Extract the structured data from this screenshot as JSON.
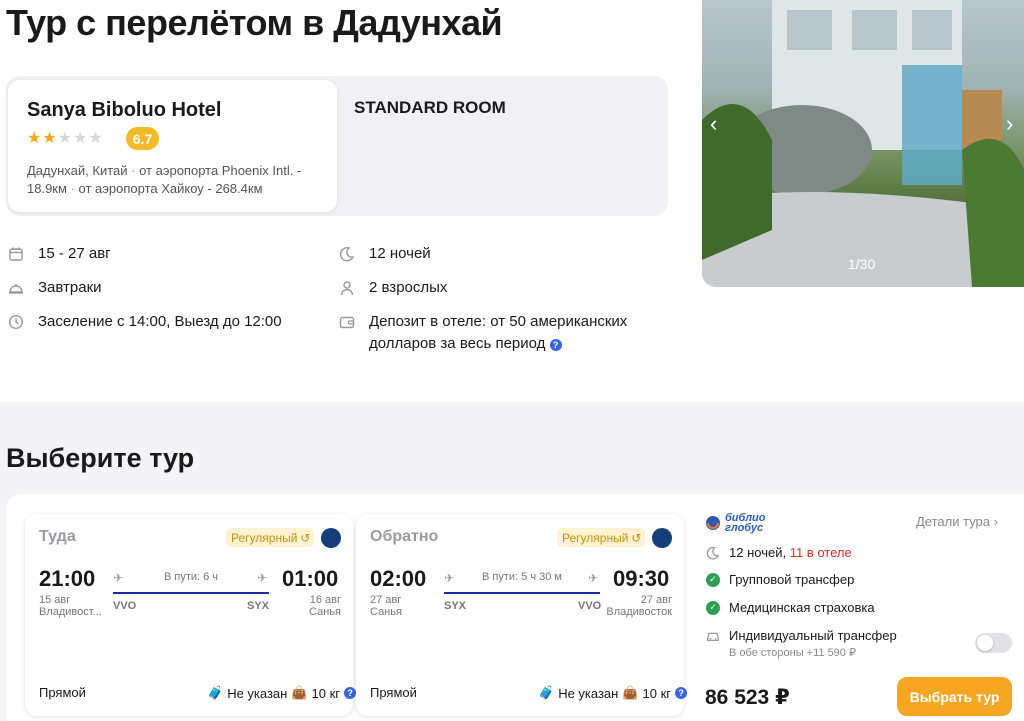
{
  "page": {
    "title": "Тур с перелётом в Дадунхай"
  },
  "hotel": {
    "name": "Sanya Biboluo Hotel",
    "stars": 2,
    "max_stars": 5,
    "rating": "6.7",
    "location": "Дадунхай, Китай",
    "distance_1": "от аэропорта Phoenix Intl. - 18.9км",
    "distance_2": "от аэропорта Хайкоу - 268.4км",
    "room": "STANDARD ROOM"
  },
  "info": {
    "dates": "15 - 27 авг",
    "nights": "12 ночей",
    "meals": "Завтраки",
    "guests": "2 взрослых",
    "checkin": "Заселение с 14:00, Выезд до 12:00",
    "deposit": "Депозит в отеле: от 50 американских долларов за весь период"
  },
  "gallery": {
    "counter": "1/30"
  },
  "tour_section": {
    "title": "Выберите тур"
  },
  "flights": {
    "outbound": {
      "title": "Туда",
      "badge": "Регулярный",
      "depart_time": "21:00",
      "depart_date": "15 авг",
      "depart_city": "Владивост...",
      "depart_code": "VVO",
      "duration": "В пути: 6 ч",
      "arrive_time": "01:00",
      "arrive_date": "16 авг",
      "arrive_city": "Санья",
      "arrive_code": "SYX",
      "type": "Прямой",
      "baggage": "Не указан",
      "hand_luggage": "10 кг"
    },
    "return": {
      "title": "Обратно",
      "badge": "Регулярный",
      "depart_time": "02:00",
      "depart_date": "27 авг",
      "depart_city": "Санья",
      "depart_code": "SYX",
      "duration": "В пути: 5 ч 30 м",
      "arrive_time": "09:30",
      "arrive_date": "27 авг",
      "arrive_city": "Владивосток",
      "arrive_code": "VVO",
      "type": "Прямой",
      "baggage": "Не указан",
      "hand_luggage": "10 кг"
    }
  },
  "summary": {
    "operator_line1": "библио",
    "operator_line2": "глобус",
    "details_link": "Детали тура",
    "nights": "12 ночей,",
    "nights_hotel": "11 в отеле",
    "transfer": "Групповой трансфер",
    "insurance": "Медицинская страховка",
    "individual_transfer": "Индивидуальный трансфер",
    "individual_transfer_note": "В обе стороны +11 590 ₽",
    "price": "86 523 ₽",
    "choose_button": "Выбрать тур"
  },
  "colors": {
    "accent": "#f5a623",
    "rating": "#f0ba28",
    "route": "#1d2aa8",
    "check": "#2e9e54",
    "alert": "#d93025"
  }
}
